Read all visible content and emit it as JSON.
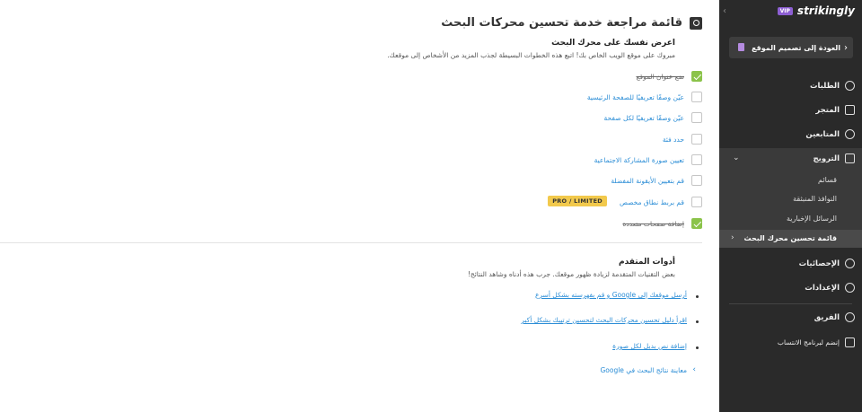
{
  "main": {
    "title": "قائمة مراجعة خدمة تحسين محركات البحث",
    "section1": {
      "heading": "اعرض نفسك على محرك البحث",
      "description": "مبروك على موقع الويب الخاص بك! اتبع هذه الخطوات البسيطة لجذب المزيد من الأشخاص إلى موقعك."
    },
    "checklist": [
      {
        "label": "ضع عنوان الموقع",
        "done": true
      },
      {
        "label": "عيّن وصفًا تعريفيًا للصفحة الرئيسية",
        "done": false
      },
      {
        "label": "عيّن وصفًا تعريفيًا لكل صفحة",
        "done": false
      },
      {
        "label": "حدد فئة",
        "done": false
      },
      {
        "label": "تعيين صورة المشاركة الاجتماعية",
        "done": false
      },
      {
        "label": "قم بتعيين الأيقونة المفضلة",
        "done": false
      },
      {
        "label": "قم بربط نطاق مخصص",
        "done": false,
        "badge": "PRO / LIMITED"
      },
      {
        "label": "إضافة صفحات متعددة",
        "done": true
      }
    ],
    "section2": {
      "heading": "أدوات المتقدم",
      "description": "بعض التقنيات المتقدمة لزيادة ظهور موقعك. جرب هذه أدناه وشاهد النتائج!"
    },
    "advanced_links": [
      "أرسل موقعك إلى Google و قم بفهرسته بشكل أسرع",
      "اقرأ دليل تحسين محركات البحث لتحسين ترتيبك بشكل أكبر",
      "إضافة نص بديل لكل صورة"
    ],
    "preview_link": "معاينة نتائج البحث في Google"
  },
  "sidebar": {
    "brand": "strikingly",
    "vip": "VIP",
    "back_button": "العودة إلى تصميم الموقع",
    "items": {
      "orders": "الطلبات",
      "store": "المتجر",
      "followers": "المتابعين",
      "promotion": "الترويج",
      "lists": "قسائم",
      "popups": "النوافذ المنبثقة",
      "newsletters": "الرسائل الإخبارية",
      "seo": "قائمة تحسين محرك البحث",
      "stats": "الإحصائيات",
      "settings": "الإعدادات",
      "team": "الفريق",
      "affiliate": "إنضم لبرنامج الانتساب"
    }
  }
}
